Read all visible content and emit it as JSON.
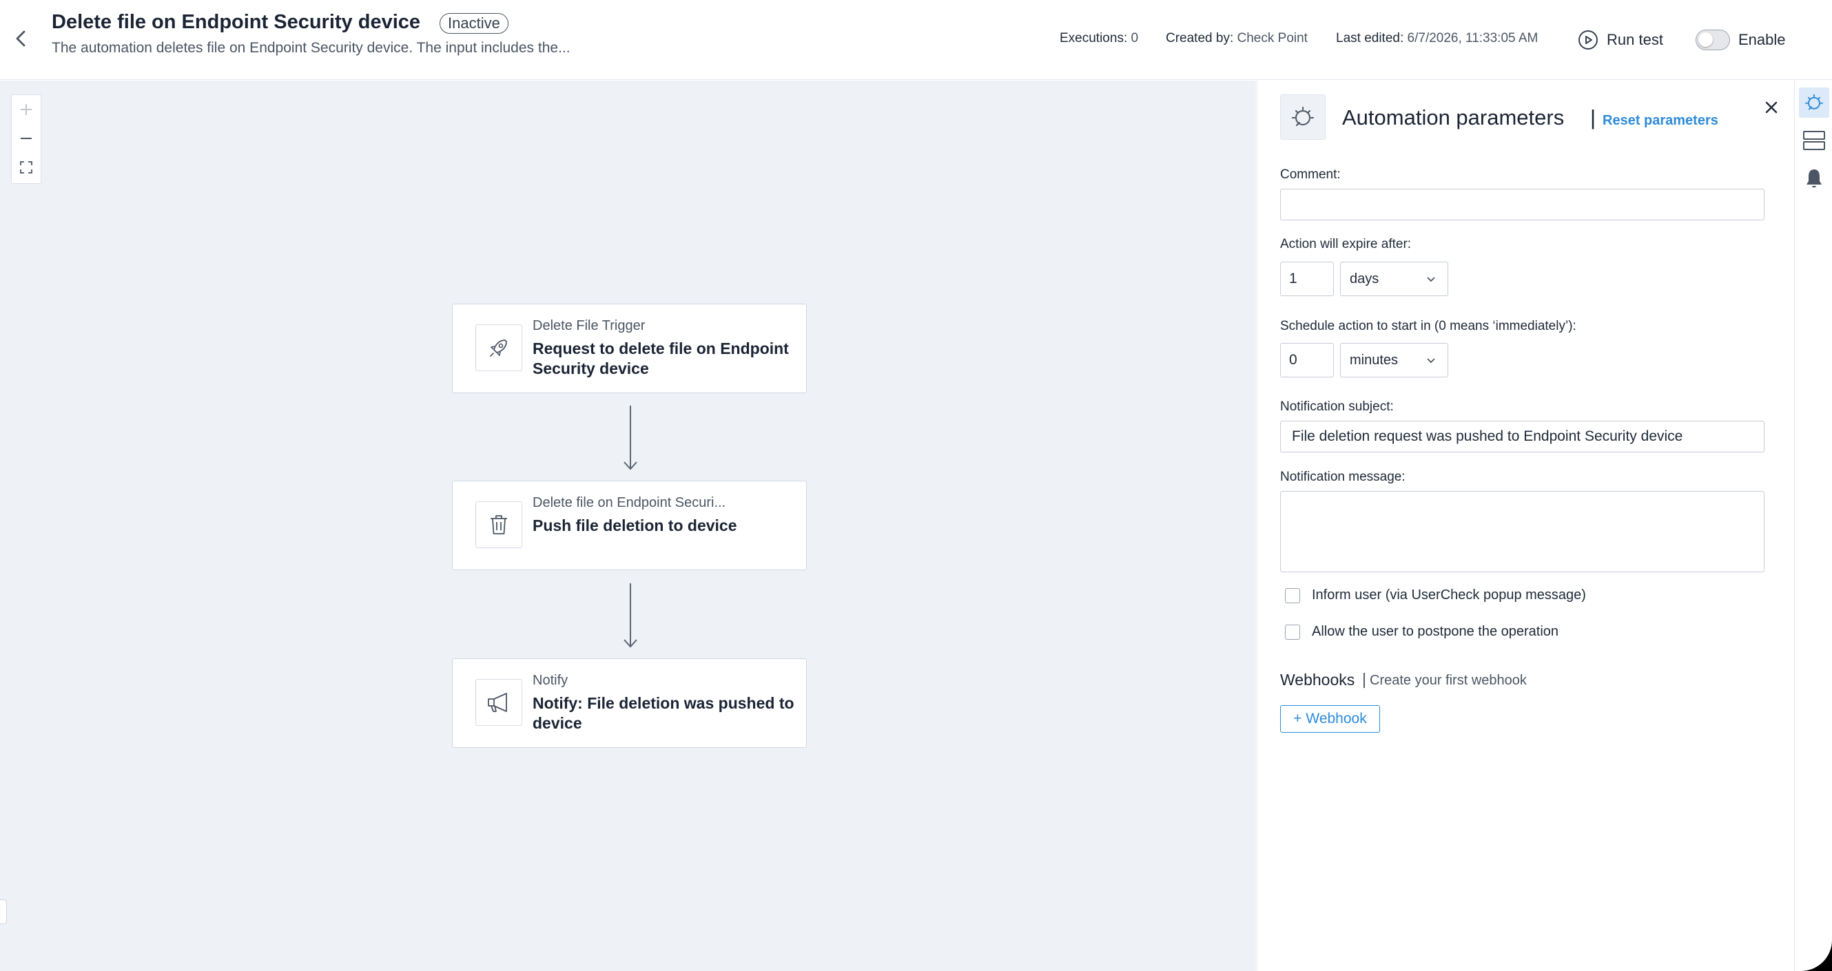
{
  "header": {
    "title": "Delete file on Endpoint Security device",
    "status": "Inactive",
    "subtitle": "The automation deletes file on Endpoint Security device. The input includes the...",
    "executions_label": "Executions:",
    "executions_value": "0",
    "created_by_label": "Created by:",
    "created_by_value": "Check Point",
    "last_edited_label": "Last edited:",
    "last_edited_value": "6/7/2026, 11:33:05 AM",
    "run_test_label": "Run test",
    "enable_label": "Enable",
    "enabled": false
  },
  "canvas": {
    "zoom_controls": [
      "zoom-in-icon",
      "zoom-out-icon",
      "fit-screen-icon"
    ],
    "nodes": [
      {
        "type": "Delete File Trigger",
        "title": "Request to delete file on Endpoint Security device",
        "icon": "rocket-icon"
      },
      {
        "type": "Delete file on Endpoint Securi...",
        "title": "Push file deletion to device",
        "icon": "trash-icon"
      },
      {
        "type": "Notify",
        "title": "Notify: File deletion was pushed to device",
        "icon": "megaphone-icon"
      }
    ]
  },
  "panel": {
    "icon": "automation-icon",
    "title": "Automation parameters",
    "separator": "|",
    "reset_label": "Reset parameters",
    "comment_label": "Comment:",
    "comment_value": "",
    "expire_label": "Action will expire after:",
    "expire_value": "1",
    "expire_unit": "days",
    "schedule_label": "Schedule action to start in (0 means ‘immediately’):",
    "schedule_value": "0",
    "schedule_unit": "minutes",
    "subject_label": "Notification subject:",
    "subject_value": "File deletion request was pushed to Endpoint Security device",
    "message_label": "Notification message:",
    "message_value": "",
    "inform_user_label": "Inform user (via UserCheck popup message)",
    "postpone_label": "Allow the user to postpone the operation",
    "webhooks_title": "Webhooks",
    "webhooks_sep": "|",
    "webhooks_link": "Create your first webhook",
    "webhook_button": "+ Webhook"
  },
  "rail": {
    "items": [
      "automation-icon",
      "layout-icon",
      "bell-icon"
    ]
  },
  "colors": {
    "accent": "#2e8bd8",
    "canvas_bg": "#eef2f7",
    "text_dark": "#1b2434"
  }
}
